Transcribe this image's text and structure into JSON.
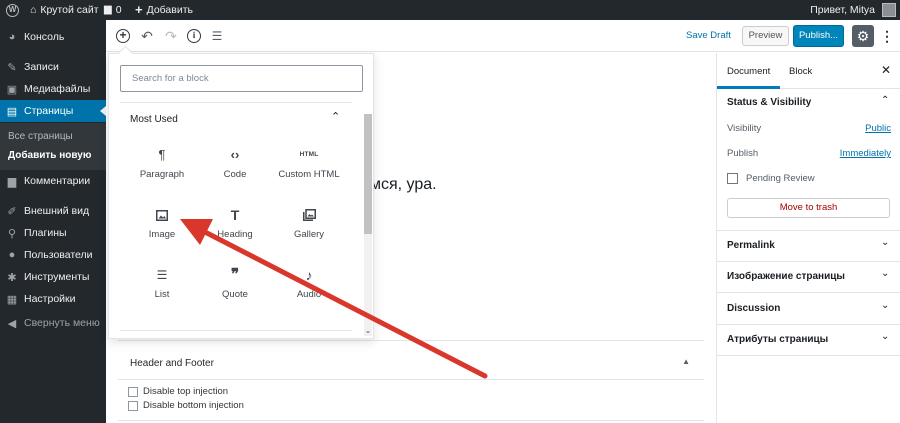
{
  "adminbar": {
    "site_name": "Крутой сайт",
    "comments_count": "0",
    "new_label": "Добавить",
    "greeting": "Привет, Mitya"
  },
  "adminmenu": {
    "items": [
      {
        "label": "Консоль",
        "icon": "dashboard-icon"
      },
      {
        "label": "Записи",
        "icon": "pin-icon"
      },
      {
        "label": "Медиафайлы",
        "icon": "media-icon"
      },
      {
        "label": "Страницы",
        "icon": "pages-icon"
      },
      {
        "label": "Комментарии",
        "icon": "comment-icon"
      },
      {
        "label": "Внешний вид",
        "icon": "brush-icon"
      },
      {
        "label": "Плагины",
        "icon": "plugin-icon"
      },
      {
        "label": "Пользователи",
        "icon": "users-icon"
      },
      {
        "label": "Инструменты",
        "icon": "wrench-icon"
      },
      {
        "label": "Настройки",
        "icon": "settings-icon"
      }
    ],
    "submenu": [
      "Все страницы",
      "Добавить новую"
    ],
    "collapse_label": "Свернуть меню"
  },
  "header": {
    "save_draft": "Save Draft",
    "preview": "Preview",
    "publish": "Publish..."
  },
  "content": {
    "visible_text": "мся, ура."
  },
  "inserter": {
    "search_placeholder": "Search for a block",
    "panel_title": "Most Used",
    "blocks": [
      {
        "label": "Paragraph",
        "icon": "paragraph-icon"
      },
      {
        "label": "Code",
        "icon": "code-icon"
      },
      {
        "label": "Custom HTML",
        "icon": "html-icon"
      },
      {
        "label": "Image",
        "icon": "image-icon"
      },
      {
        "label": "Heading",
        "icon": "heading-icon"
      },
      {
        "label": "Gallery",
        "icon": "gallery-icon"
      },
      {
        "label": "List",
        "icon": "list-icon"
      },
      {
        "label": "Quote",
        "icon": "quote-icon"
      },
      {
        "label": "Audio",
        "icon": "audio-icon"
      }
    ],
    "html_icon_text": "HTML"
  },
  "metabox": {
    "title": "Header and Footer",
    "options": [
      "Disable top injection",
      "Disable bottom injection"
    ]
  },
  "sidebar": {
    "tabs": [
      "Document",
      "Block"
    ],
    "status_title": "Status & Visibility",
    "visibility_label": "Visibility",
    "visibility_value": "Public",
    "publish_label": "Publish",
    "publish_value": "Immediately",
    "pending_review": "Pending Review",
    "trash": "Move to trash",
    "sections": [
      "Permalink",
      "Изображение страницы",
      "Discussion",
      "Атрибуты страницы"
    ]
  },
  "colors": {
    "admin_dark": "#23282d",
    "admin_blue": "#0073aa",
    "publish_blue": "#0085ba",
    "trash_red": "#aa0000",
    "annotation_red": "#d9372b"
  }
}
